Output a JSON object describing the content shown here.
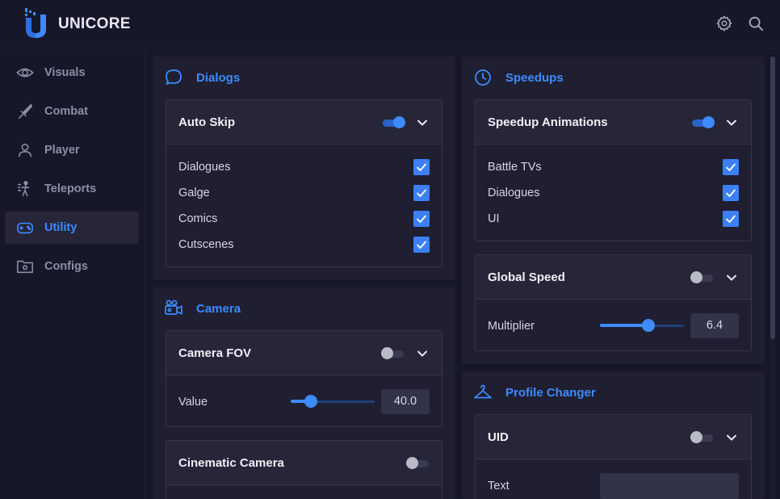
{
  "app": {
    "brand": "UNICORE"
  },
  "header": {
    "settings_icon": "gear-icon",
    "search_icon": "search-icon"
  },
  "sidebar": {
    "items": [
      {
        "label": "Visuals",
        "icon": "eye-icon"
      },
      {
        "label": "Combat",
        "icon": "sword-icon"
      },
      {
        "label": "Player",
        "icon": "user-icon"
      },
      {
        "label": "Teleports",
        "icon": "teleport-icon"
      },
      {
        "label": "Utility",
        "icon": "gamepad-icon",
        "active": true
      },
      {
        "label": "Configs",
        "icon": "folder-gear-icon"
      }
    ]
  },
  "colors": {
    "accent": "#3d8bff",
    "background": "#17172a",
    "panel": "#1f1f31"
  },
  "dialogs": {
    "title": "Dialogs",
    "auto_skip": {
      "title": "Auto Skip",
      "enabled": true,
      "options": [
        {
          "label": "Dialogues",
          "checked": true
        },
        {
          "label": "Galge",
          "checked": true
        },
        {
          "label": "Comics",
          "checked": true
        },
        {
          "label": "Cutscenes",
          "checked": true
        }
      ]
    }
  },
  "camera": {
    "title": "Camera",
    "camera_fov": {
      "title": "Camera FOV",
      "enabled": false,
      "value_label": "Value",
      "value": "40.0",
      "slider_fraction": 0.24
    },
    "cinematic_camera": {
      "title": "Cinematic Camera",
      "enabled": false
    }
  },
  "speedups": {
    "title": "Speedups",
    "speedup_animations": {
      "title": "Speedup Animations",
      "enabled": true,
      "options": [
        {
          "label": "Battle TVs",
          "checked": true
        },
        {
          "label": "Dialogues",
          "checked": true
        },
        {
          "label": "UI",
          "checked": true
        }
      ]
    },
    "global_speed": {
      "title": "Global Speed",
      "enabled": false,
      "multiplier_label": "Multiplier",
      "multiplier": "6.4",
      "slider_fraction": 0.58
    }
  },
  "profile_changer": {
    "title": "Profile Changer",
    "uid": {
      "title": "UID",
      "enabled": false,
      "text_label": "Text",
      "text_value": ""
    }
  }
}
